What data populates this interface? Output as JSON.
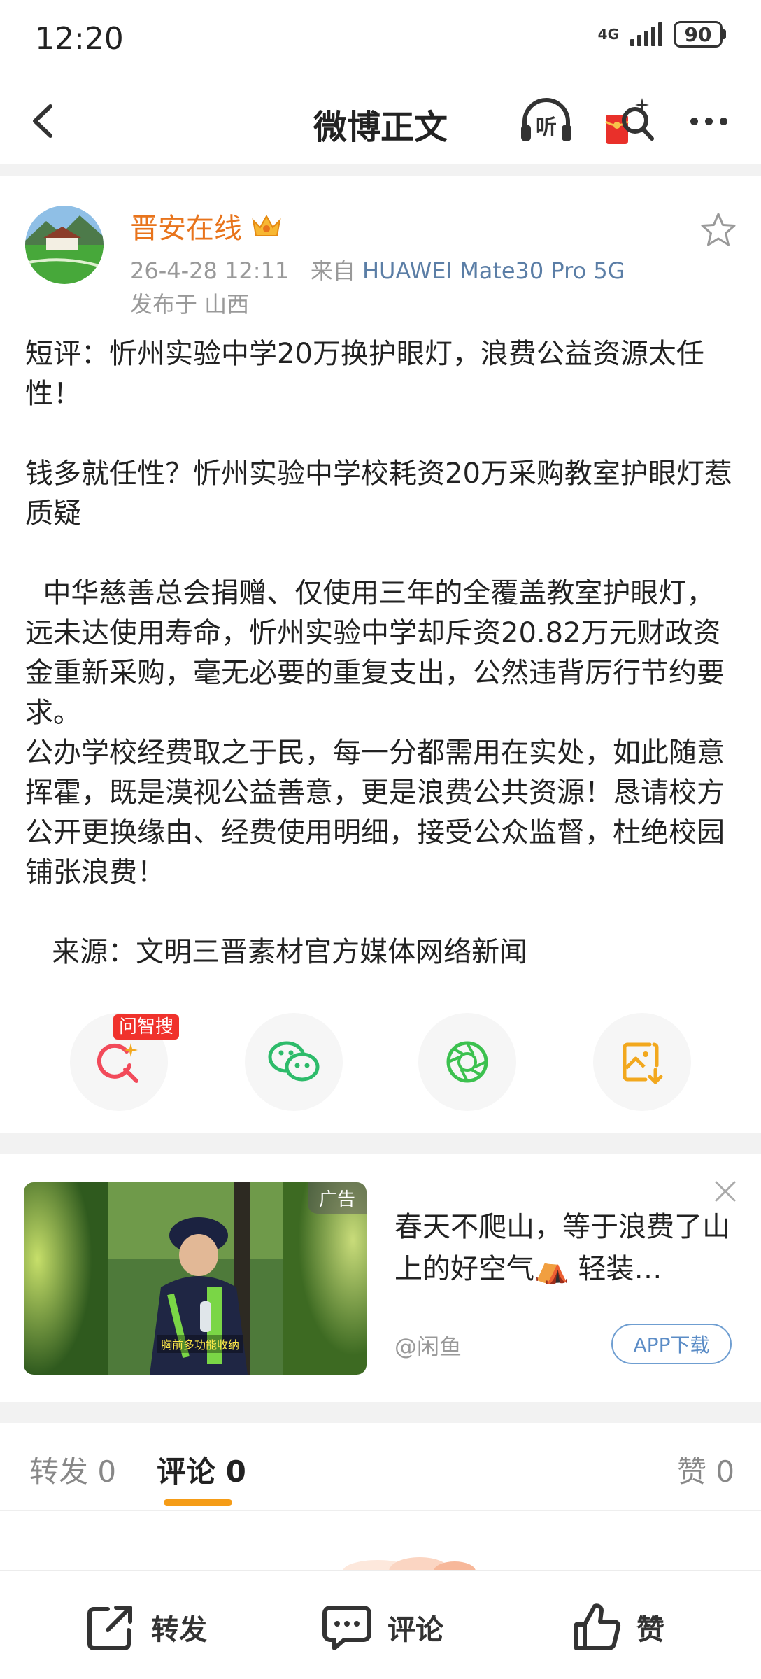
{
  "status_bar": {
    "time": "12:20",
    "network": "4G",
    "battery": "90"
  },
  "nav": {
    "title": "微博正文",
    "icons": [
      "back-arrow-icon",
      "listen-icon",
      "red-packet-icon",
      "more-icon"
    ],
    "listen_label": "听"
  },
  "post": {
    "author": "晋安在线",
    "timestamp": "26-4-28 12:11",
    "from_prefix": "来自",
    "device": "HUAWEI Mate30 Pro 5G",
    "location": "发布于 山西",
    "paragraphs": [
      "短评：忻州实验中学20万换护眼灯，浪费公益资源太任性！",
      "",
      "钱多就任性？忻州实验中学校耗资20万采购教室护眼灯惹质疑",
      "",
      "  中华慈善总会捐赠、仅使用三年的全覆盖教室护眼灯，远未达使用寿命，忻州实验中学却斥资20.82万元财政资金重新采购，毫无必要的重复支出，公然违背厉行节约要求。",
      "公办学校经费取之于民，每一分都需用在实处，如此随意挥霍，既是漠视公益善意，更是浪费公共资源！恳请校方公开更换缘由、经费使用明细，接受公众监督，杜绝校园铺张浪费！",
      "",
      "   来源：文明三晋素材官方媒体网络新闻"
    ]
  },
  "actions": {
    "ai_badge": "问智搜",
    "icons": [
      "ai-search-icon",
      "wechat-icon",
      "moments-icon",
      "save-image-icon"
    ]
  },
  "ad": {
    "tag": "广告",
    "title": "春天不爬山，等于浪费了山上的好空气⛺ 轻装…",
    "source": "@闲鱼",
    "download": "APP下载",
    "image_caption": "胸前多功能收纳"
  },
  "tabs": {
    "repost": "转发 0",
    "comment": "评论 0",
    "like": "赞 0"
  },
  "bottom": {
    "repost": "转发",
    "comment": "评论",
    "like": "赞"
  },
  "colors": {
    "author": "#e8741c",
    "device_link": "#5b7ea6",
    "tab_underline": "#f59c17",
    "ai_badge": "#f0322c",
    "wechat": "#2dbb6a",
    "save": "#f2a81e"
  }
}
